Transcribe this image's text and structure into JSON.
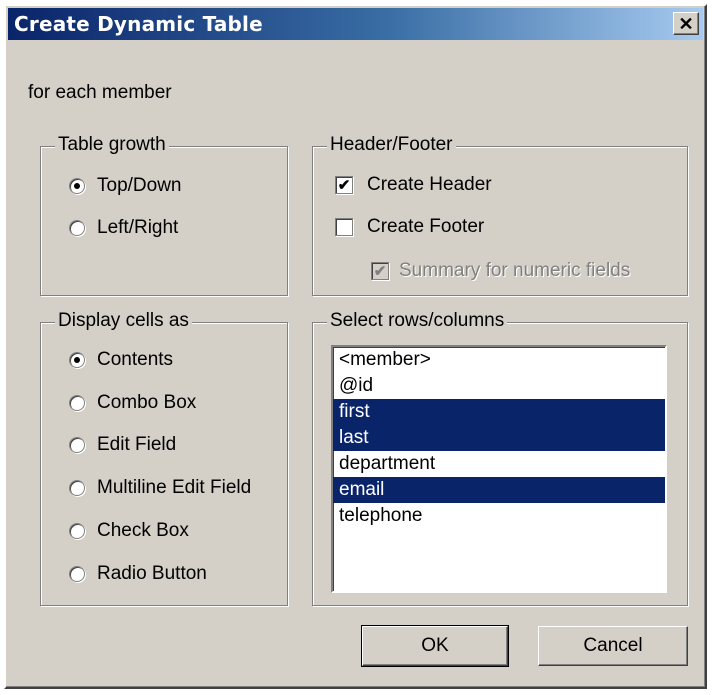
{
  "window": {
    "title": "Create Dynamic Table",
    "close_glyph": "✕"
  },
  "context_label": "for each member",
  "table_growth": {
    "legend": "Table growth",
    "options": [
      {
        "label": "Top/Down",
        "selected": true
      },
      {
        "label": "Left/Right",
        "selected": false
      }
    ]
  },
  "header_footer": {
    "legend": "Header/Footer",
    "create_header": {
      "label": "Create Header",
      "checked": true
    },
    "create_footer": {
      "label": "Create Footer",
      "checked": false
    },
    "summary": {
      "label": "Summary for numeric fields",
      "checked": true,
      "disabled": true
    }
  },
  "display_cells": {
    "legend": "Display cells as",
    "options": [
      {
        "label": "Contents",
        "selected": true
      },
      {
        "label": "Combo Box",
        "selected": false
      },
      {
        "label": "Edit Field",
        "selected": false
      },
      {
        "label": "Multiline Edit Field",
        "selected": false
      },
      {
        "label": "Check Box",
        "selected": false
      },
      {
        "label": "Radio Button",
        "selected": false
      }
    ]
  },
  "select_rows": {
    "legend": "Select rows/columns",
    "items": [
      {
        "label": "<member>",
        "selected": false
      },
      {
        "label": "@id",
        "selected": false
      },
      {
        "label": "first",
        "selected": true
      },
      {
        "label": "last",
        "selected": true
      },
      {
        "label": "department",
        "selected": false
      },
      {
        "label": "email",
        "selected": true
      },
      {
        "label": "telephone",
        "selected": false
      }
    ]
  },
  "buttons": {
    "ok": "OK",
    "cancel": "Cancel"
  },
  "colors": {
    "titlebar_start": "#0a246a",
    "selection": "#0a246a",
    "face": "#d4d0c8"
  }
}
